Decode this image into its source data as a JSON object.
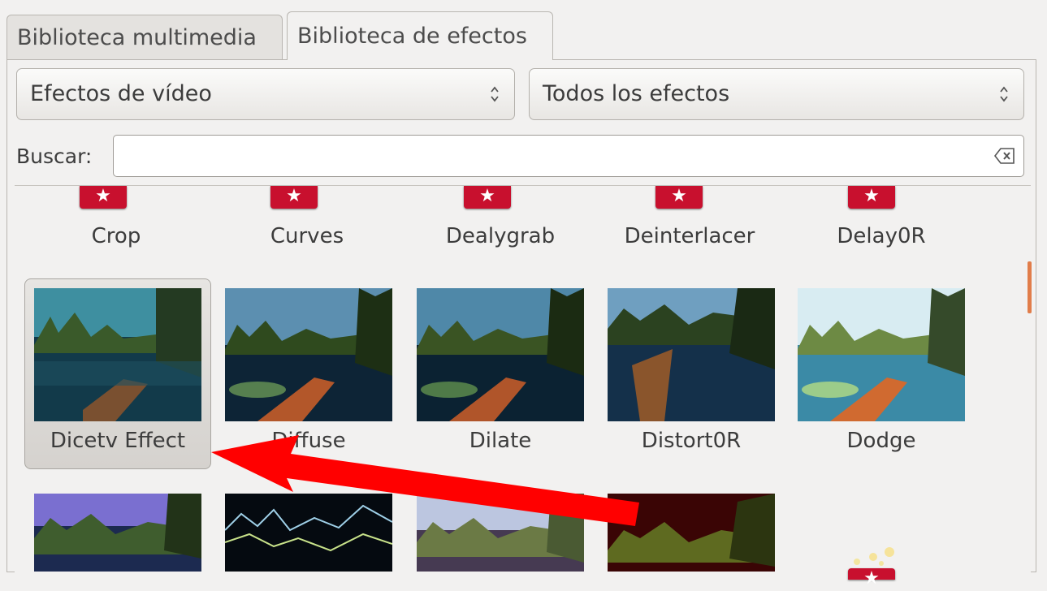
{
  "tabs": [
    {
      "label": "Biblioteca multimedia"
    },
    {
      "label": "Biblioteca de efectos"
    }
  ],
  "filters": {
    "category": "Efectos de vídeo",
    "group": "Todos los efectos"
  },
  "search": {
    "label": "Buscar:",
    "value": ""
  },
  "effects": {
    "row1": [
      "Crop",
      "Curves",
      "Dealygrab",
      "Deinterlacer",
      "Delay0R"
    ],
    "row2": [
      "Dicetv Effect",
      "Diffuse",
      "Dilate",
      "Distort0R",
      "Dodge"
    ]
  },
  "colors": {
    "favorite_badge": "#c8102e",
    "annotation_arrow": "#ff0000",
    "scroll_accent": "#e17d4a"
  }
}
